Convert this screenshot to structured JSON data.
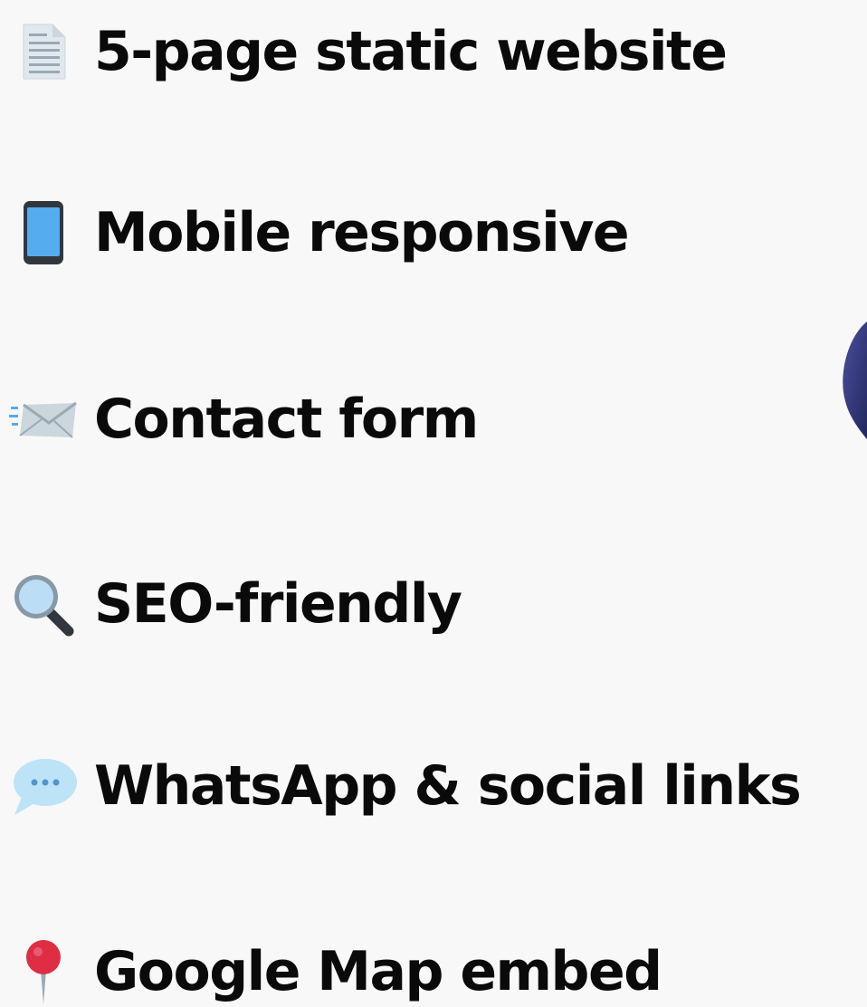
{
  "features": [
    {
      "icon": "page-document-icon",
      "label": "5-page static website"
    },
    {
      "icon": "mobile-phone-icon",
      "label": "Mobile responsive"
    },
    {
      "icon": "incoming-envelope-icon",
      "label": "Contact form"
    },
    {
      "icon": "magnifying-glass-icon",
      "label": "SEO-friendly"
    },
    {
      "icon": "speech-bubble-icon",
      "label": "WhatsApp & social links"
    },
    {
      "icon": "round-pushpin-icon",
      "label": "Google Map embed"
    }
  ],
  "colors": {
    "background": "#f8f8f8",
    "text": "#0a0a0a",
    "phone_screen": "#55acee",
    "bubble": "#bde3f7",
    "pin_head": "#dd2e44",
    "edge_shape": "#3a3f8f"
  }
}
